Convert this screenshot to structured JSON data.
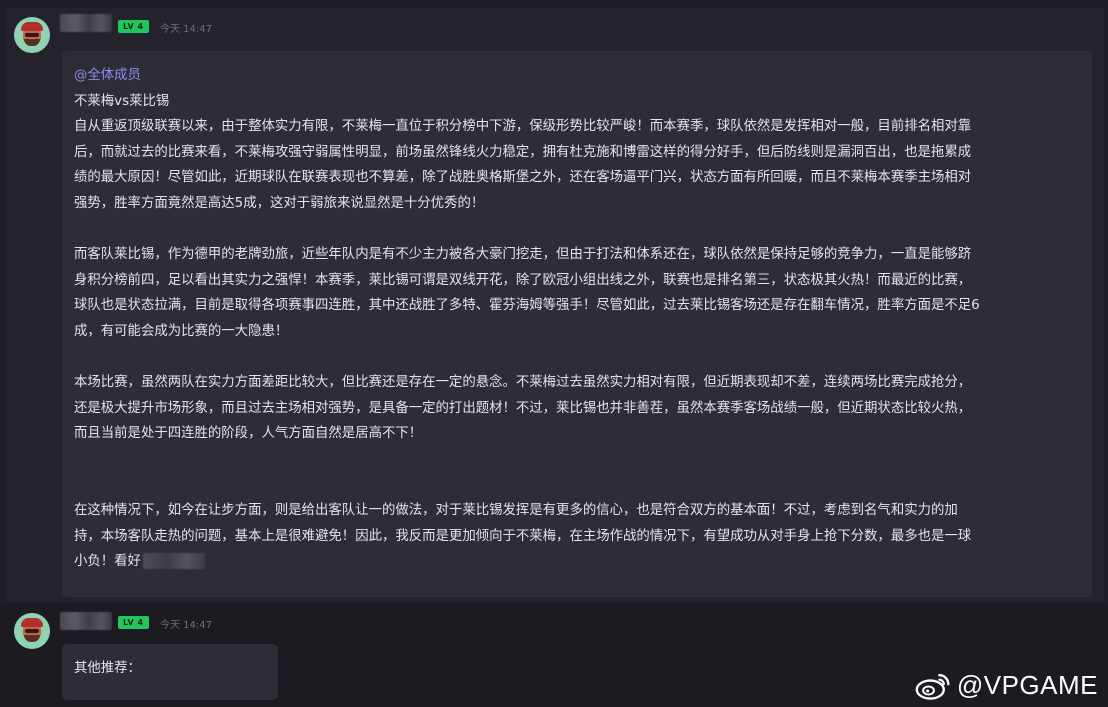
{
  "posts": [
    {
      "level": "LV 4",
      "time": "今天 14:47",
      "mention": "@全体成员",
      "lines": [
        "不莱梅vs莱比锡",
        "自从重返顶级联赛以来，由于整体实力有限，不莱梅一直位于积分榜中下游，保级形势比较严峻！而本赛季，球队依然是发挥相对一般，目前排名相对靠",
        "后，而就过去的比赛来看，不莱梅攻强守弱属性明显，前场虽然锋线火力稳定，拥有杜克施和博雷这样的得分好手，但后防线则是漏洞百出，也是拖累成",
        "绩的最大原因！尽管如此，近期球队在联赛表现也不算差，除了战胜奥格斯堡之外，还在客场逼平门兴，状态方面有所回暖，而且不莱梅本赛季主场相对",
        "强势，胜率方面竟然是高达5成，这对于弱旅来说显然是十分优秀的！",
        "而客队莱比锡，作为德甲的老牌劲旅，近些年队内是有不少主力被各大豪门挖走，但由于打法和体系还在，球队依然是保持足够的竞争力，一直是能够跻",
        "身积分榜前四，足以看出其实力之强悍！本赛季，莱比锡可谓是双线开花，除了欧冠小组出线之外，联赛也是排名第三，状态极其火热！而最近的比赛，",
        "球队也是状态拉满，目前是取得各项赛事四连胜，其中还战胜了多特、霍芬海姆等强手！尽管如此，过去莱比锡客场还是存在翻车情况，胜率方面是不足6",
        "成，有可能会成为比赛的一大隐患！",
        "本场比赛，虽然两队在实力方面差距比较大，但比赛还是存在一定的悬念。不莱梅过去虽然实力相对有限，但近期表现却不差，连续两场比赛完成抢分，",
        "还是极大提升市场形象，而且过去主场相对强势，是具备一定的打出题材！不过，莱比锡也并非善茬，虽然本赛季客场战绩一般，但近期状态比较火热，",
        "而且当前是处于四连胜的阶段，人气方面自然是居高不下！",
        "在这种情况下，如今在让步方面，则是给出客队让一的做法，对于莱比锡发挥是有更多的信心，也是符合双方的基本面！不过，考虑到名气和实力的加",
        "持，本场客队走热的问题，基本上是很难避免！因此，我反而是更加倾向于不莱梅，在主场作战的情况下，有望成功从对手身上抢下分数，最多也是一球",
        "小负！看好"
      ]
    },
    {
      "level": "LV 4",
      "time": "今天 14:47",
      "text": "其他推荐："
    }
  ],
  "watermark": {
    "text": "@VPGAME",
    "icon": "weibo-icon"
  },
  "colors": {
    "background": "#1c1b22",
    "bubble": "#2e2d36",
    "mention": "#8c8cf0",
    "level_badge": "#22c55e"
  }
}
